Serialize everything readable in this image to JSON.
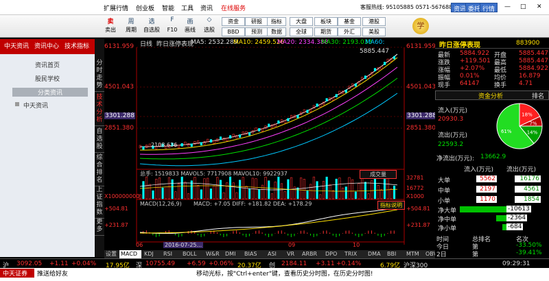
{
  "menu": {
    "items": [
      "扩展行情",
      "创业板",
      "智能",
      "工具",
      "资讯"
    ],
    "hot": "在线服务",
    "hotline": "客服热线: 95105885  0571-56768888",
    "btns": [
      "资讯",
      "委托",
      "行情"
    ],
    "winctrl": [
      "—",
      "□",
      "✕"
    ]
  },
  "toolbar": {
    "big": [
      {
        "ic": "卖",
        "lb": "卖出"
      },
      {
        "ic": "周",
        "lb": "周期"
      },
      {
        "ic": "选",
        "lb": "自选股"
      },
      {
        "ic": "F",
        "lb": "F10"
      },
      {
        "ic": "画",
        "lb": "画线"
      },
      {
        "ic": "◇",
        "lb": "选股"
      }
    ],
    "small": [
      "资金",
      "研报",
      "BBD",
      "预测",
      "指标",
      "数据",
      "大盘",
      "全球",
      "板块",
      "期货",
      "基金",
      "外汇",
      "港股",
      "美股"
    ],
    "ball": "学"
  },
  "left": {
    "tabs": [
      "中天资讯",
      "资讯中心",
      "技术指标"
    ],
    "menu": [
      "资讯首页",
      "股民学校",
      "分类资讯"
    ],
    "tree": "中天资讯"
  },
  "vtabs": [
    "分时走势",
    "技术分析",
    "自选股",
    "综合排名",
    "上证指数",
    "更多"
  ],
  "chart": {
    "header": {
      "period": "日线",
      "title": "昨日涨停表现",
      "ma5": "MA5: 2532.289",
      "ma10": "MA10: 2459.526",
      "ma20": "MA20: 2334.388",
      "ma30": "MA30: 2193.033",
      "ma60": "MA60:"
    },
    "y": [
      "6131.959",
      "4501.043",
      "3301.288",
      "2851.380"
    ],
    "ry": [
      "6131.959",
      "4501.043",
      "3301.288",
      "2851.380"
    ],
    "high": "5885.447",
    "low": "2108.636",
    "vol": {
      "label": "总手: 1519833 MAVOL5: 7717908 MAVOL10: 9922937",
      "btn": "成交量",
      "scale": "X100000000",
      "r": [
        "32781",
        "16772",
        "X1000"
      ]
    },
    "macd": {
      "label": "MACD(12,26,9)",
      "values": "MACD: +7.05  DIFF: +181.82  DEA: +178.29",
      "btn": "指标说明",
      "y": [
        "+504.81",
        "+231.87"
      ],
      "ry": [
        "+504.81",
        "+231.87"
      ]
    },
    "x": [
      "06",
      "2016-07-25...",
      "09",
      "10"
    ],
    "tabs": [
      "设置",
      "MACD",
      "KDJ",
      "RSI",
      "BOLL",
      "W&R",
      "DMI",
      "BIAS",
      "ASI",
      "VR",
      "ARBR",
      "DPO",
      "TRIX",
      "DMA",
      "BBI",
      "MTM",
      "OBV"
    ]
  },
  "right": {
    "title": "昨日涨停表现",
    "code": "883900",
    "stats": [
      [
        "最新",
        "5884.922",
        "开盘",
        "5885.447"
      ],
      [
        "涨跌",
        "+119.501",
        "最高",
        "5885.447"
      ],
      [
        "涨幅",
        "+2.07%",
        "最低",
        "5884.922"
      ],
      [
        "振幅",
        "0.01%",
        "均价",
        "16.879"
      ],
      [
        "现手",
        "64147",
        "换手",
        "4.71"
      ]
    ],
    "fund_title": "资金分析",
    "rank": "排名",
    "inflow_label": "流入(万元)",
    "inflow": "20930.3",
    "outflow_label": "流出(万元)",
    "outflow": "22593.2",
    "net": "净流出(万元):",
    "net_val": "13662.9",
    "pie": [
      {
        "name": "18%",
        "value": 18,
        "color": "#ff2020"
      },
      {
        "name": "7%",
        "value": 7,
        "color": "#c00000"
      },
      {
        "name": "14%",
        "value": 14,
        "color": "#00a000"
      },
      {
        "name": "61%",
        "value": 61,
        "color": "#22dd22"
      }
    ],
    "cols": [
      "流入(万元)",
      "流出(万元)"
    ],
    "rows": [
      [
        "大单",
        "5562",
        "16176"
      ],
      [
        "中单",
        "2197",
        "4561"
      ],
      [
        "小单",
        "1170",
        "1854"
      ]
    ],
    "netrows": [
      [
        "净大单",
        "-10613"
      ],
      [
        "净中单",
        "-2364"
      ],
      [
        "净小单",
        "-684"
      ]
    ],
    "bottom": [
      [
        "时间",
        "总排名",
        "名次"
      ],
      [
        "今日",
        "第",
        "-33.50%"
      ],
      [
        "2日",
        "第",
        "-39.41%"
      ]
    ]
  },
  "status": {
    "idx1": "沪",
    "v1": "3092.05",
    "c1": "+1.11",
    "p1": "+0.04%",
    "a1": "17.95亿",
    "n2": "深",
    "v2": "10755.49",
    "c2": "+6.59",
    "p2": "+0.06%",
    "a2": "20.37亿",
    "n3": "创",
    "v3": "2184.11",
    "c3": "+3.11",
    "p3": "+0.14%",
    "a3": "6.79亿",
    "n4": "沪深300",
    "time": "09:29:31"
  },
  "status2": {
    "brand": "中天证券",
    "push": "推送给好友",
    "tip": "移动光标，按\"Ctrl+enter\"键，查看历史分时图，在历史分时图!"
  },
  "colors": {
    "accent": "#c00000",
    "up": "#ff3030",
    "down": "#00e000"
  }
}
